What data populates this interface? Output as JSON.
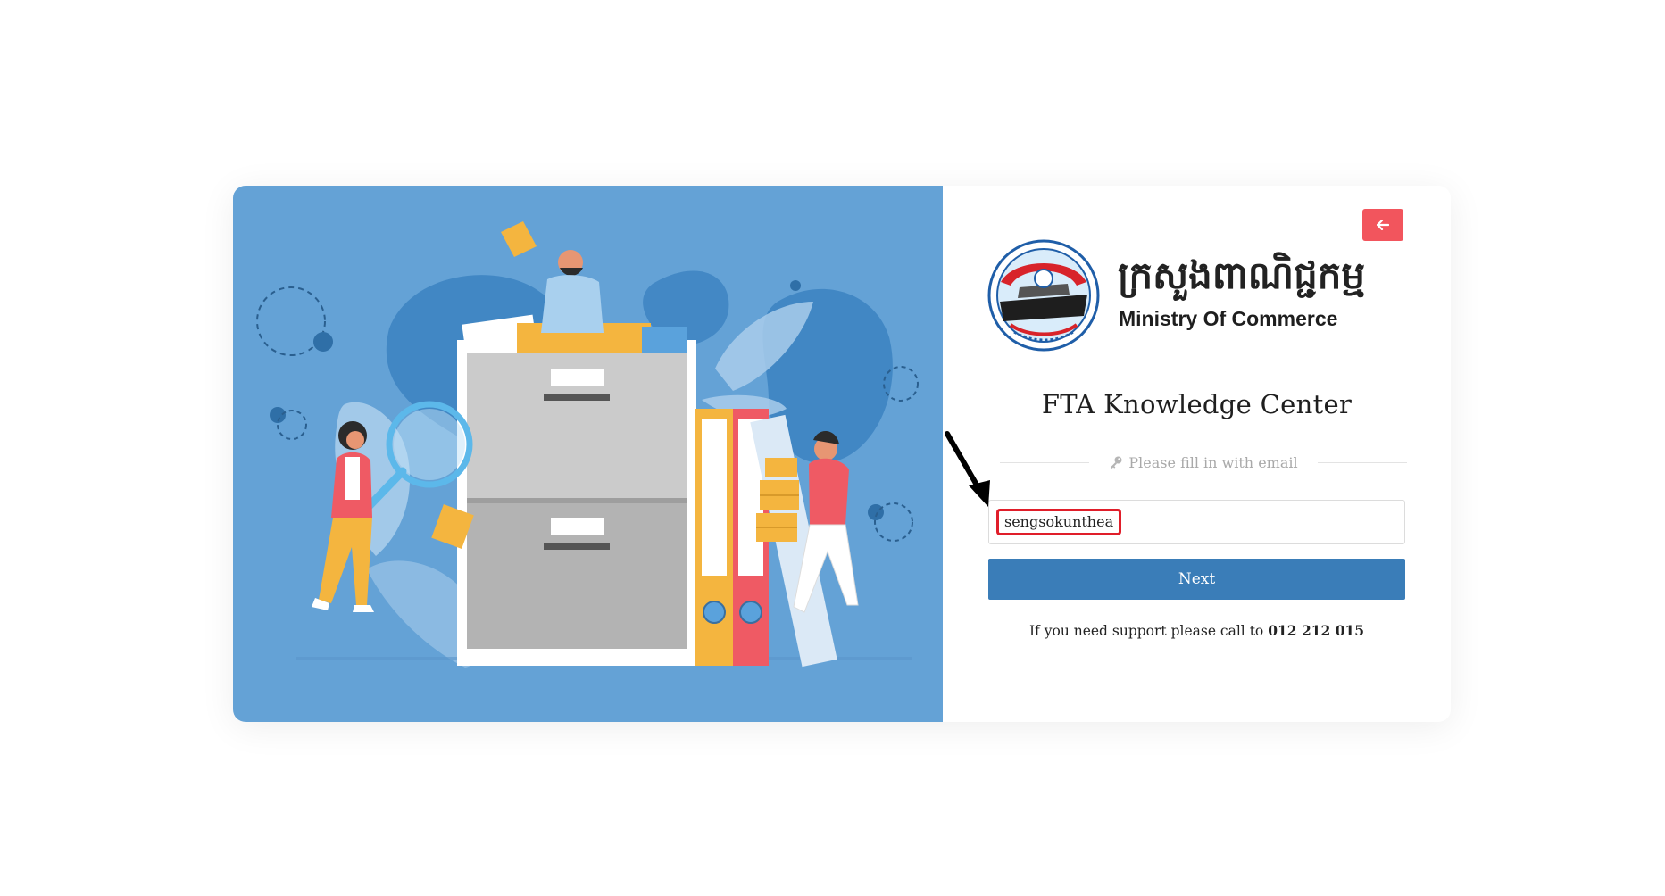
{
  "illustration": {
    "description_icon": "filing-cabinet-illustration"
  },
  "header": {
    "back_icon": "arrow-left-icon"
  },
  "logo": {
    "khmer_name": "ក្រសួងពាណិជ្ជកម្ម",
    "english_name": "Ministry Of Commerce"
  },
  "main": {
    "title": "FTA Knowledge Center",
    "hint_icon": "key-icon",
    "hint": "Please fill in with email"
  },
  "form": {
    "email_value": "sengsokunthea",
    "next_label": "Next"
  },
  "support": {
    "text": "If you need support please call to",
    "phone": "012 212 015"
  },
  "colors": {
    "accent_blue": "#3a7db8",
    "illustration_bg": "#64a2d6",
    "back_button": "#f2555d",
    "highlight": "#e01e2a"
  }
}
